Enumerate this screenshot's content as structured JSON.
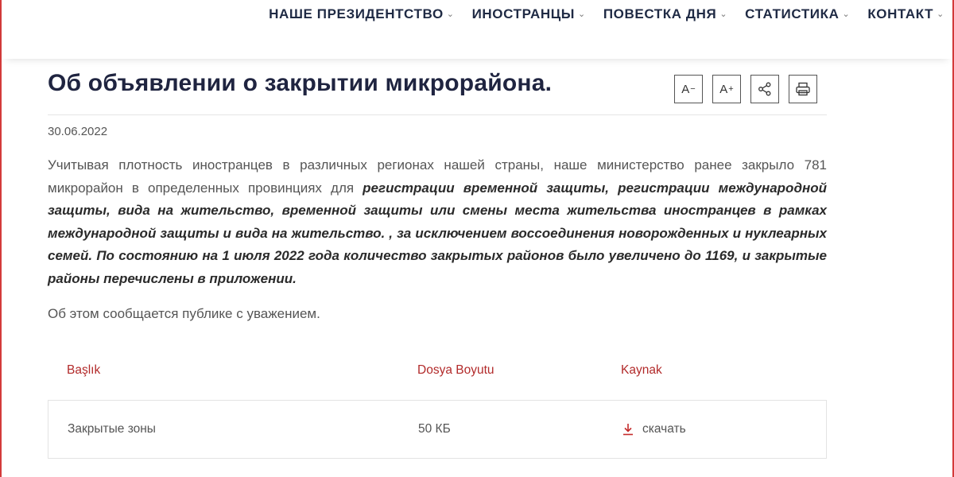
{
  "nav": {
    "items": [
      {
        "label": "НАШЕ ПРЕЗИДЕНТСТВО"
      },
      {
        "label": "ИНОСТРАНЦЫ"
      },
      {
        "label": "ПОВЕСТКА ДНЯ"
      },
      {
        "label": "СТАТИСТИКА"
      },
      {
        "label": "КОНТАКТ"
      }
    ]
  },
  "article": {
    "title": "Об объявлении о закрытии микрорайона.",
    "date": "30.06.2022",
    "para1_plain": "Учитывая плотность иностранцев в различных регионах нашей страны, наше министерство ранее закрыло 781 микрорайон в определенных провинциях для ",
    "para1_emph": "регистрации временной защиты, регистрации международной защиты, вида на жительство, временной защиты или смены места жительства иностранцев в рамках международной защиты и вида на жительство. , за исключением воссоединения новорожденных и нуклеарных семей. По состоянию на 1 июля 2022 года количество закрытых районов было увеличено до 1169, и закрытые районы перечислены в приложении.",
    "para2": "Об этом сообщается публике с уважением."
  },
  "tools": {
    "decrease_label": "A",
    "decrease_mark": "−",
    "increase_label": "A",
    "increase_mark": "+"
  },
  "files": {
    "headers": {
      "title": "Başlık",
      "size": "Dosya Boyutu",
      "source": "Kaynak"
    },
    "rows": [
      {
        "title": "Закрытые зоны",
        "size": "50 КБ",
        "action": "скачать"
      }
    ]
  },
  "colors": {
    "accent": "#c42b2b",
    "heading": "#1f2440"
  }
}
